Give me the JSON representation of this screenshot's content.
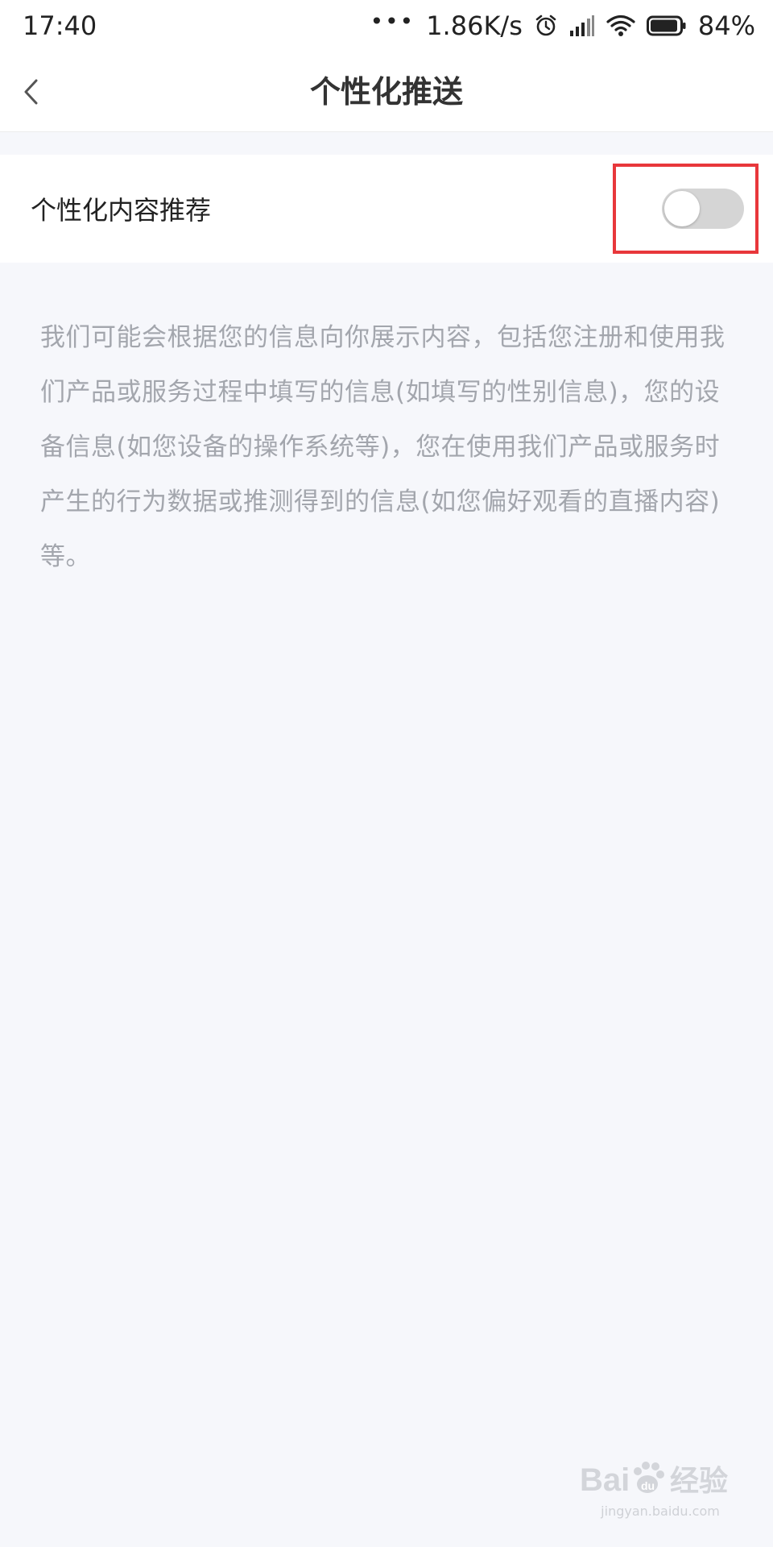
{
  "status_bar": {
    "time": "17:40",
    "dots": "•••",
    "network_speed": "1.86K/s",
    "battery": "84%",
    "icons": [
      "alarm-icon",
      "signal-icon",
      "wifi-icon",
      "battery-icon"
    ]
  },
  "header": {
    "title": "个性化推送",
    "back_icon": "chevron-left-icon"
  },
  "setting": {
    "label": "个性化内容推荐",
    "toggle_on": false,
    "highlight_color": "#e8373b"
  },
  "description": "我们可能会根据您的信息向你展示内容，包括您注册和使用我们产品或服务过程中填写的信息(如填写的性别信息)，您的设备信息(如您设备的操作系统等)，您在使用我们产品或服务时产生的行为数据或推测得到的信息(如您偏好观看的直播内容)等。",
  "watermark": {
    "brand": "Bai du 经验",
    "url": "jingyan.baidu.com"
  }
}
